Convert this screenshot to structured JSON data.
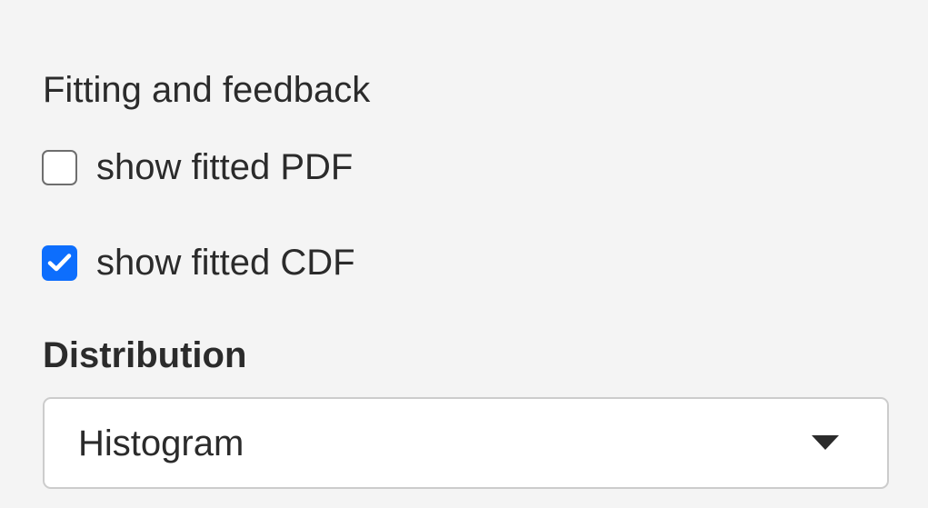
{
  "fitting": {
    "heading": "Fitting and feedback",
    "options": [
      {
        "label": "show fitted PDF",
        "checked": false
      },
      {
        "label": "show fitted CDF",
        "checked": true
      }
    ]
  },
  "distribution": {
    "label": "Distribution",
    "selected": "Histogram"
  },
  "icons": {
    "checkmark": "check-icon",
    "dropdown": "caret-down-icon"
  },
  "colors": {
    "background": "#f4f4f4",
    "accent": "#0d6efd",
    "text": "#2b2b2b",
    "border": "#cccccc"
  }
}
